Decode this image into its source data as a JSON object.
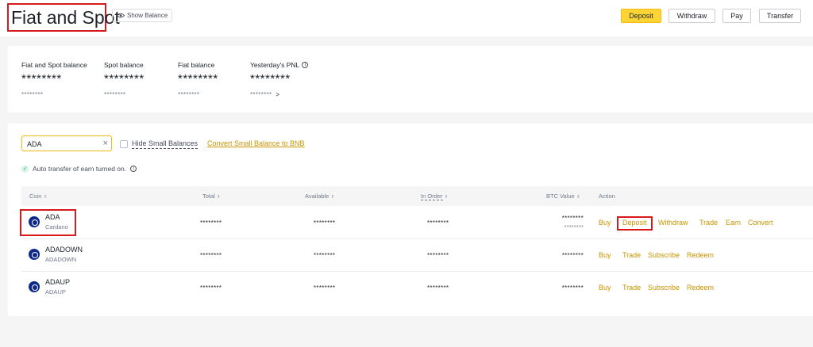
{
  "header": {
    "title": "Fiat and Spot",
    "show_balance": "Show Balance",
    "buttons": {
      "deposit": "Deposit",
      "withdraw": "Withdraw",
      "pay": "Pay",
      "transfer": "Transfer"
    },
    "accent_color": "#fcd535",
    "highlight_color": "#d7191b"
  },
  "balances": [
    {
      "label": "Fiat and Spot balance",
      "value": "********",
      "sub": "********"
    },
    {
      "label": "Spot balance",
      "value": "********",
      "sub": "********"
    },
    {
      "label": "Fiat balance",
      "value": "********",
      "sub": "********"
    },
    {
      "label": "Yesterday's PNL",
      "value": "********",
      "sub": "********",
      "info_icon": "info-icon",
      "arrow": ">"
    }
  ],
  "filters": {
    "search_value": "ADA",
    "hide_small_label": "Hide Small Balances",
    "convert_label": "Convert Small Balance to BNB",
    "auto_transfer": "Auto transfer of earn turned on."
  },
  "table": {
    "headers": {
      "coin": "Coin",
      "total": "Total",
      "available": "Available",
      "in_order": "In Order",
      "btc_value": "BTC Value",
      "action": "Action"
    },
    "rows": [
      {
        "symbol": "ADA",
        "name": "Cardano",
        "total": "********",
        "available": "********",
        "in_order": "********",
        "btc_value": "********",
        "btc_value_sub": "********",
        "actions": {
          "buy": "Buy",
          "deposit": "Deposit",
          "withdraw": "Withdraw",
          "trade": "Trade",
          "earn": "Earn",
          "convert": "Convert"
        }
      },
      {
        "symbol": "ADADOWN",
        "name": "ADADOWN",
        "total": "********",
        "available": "********",
        "in_order": "********",
        "btc_value": "********",
        "actions": {
          "buy": "Buy",
          "trade": "Trade",
          "subscribe": "Subscribe",
          "redeem": "Redeem"
        }
      },
      {
        "symbol": "ADAUP",
        "name": "ADAUP",
        "total": "********",
        "available": "********",
        "in_order": "********",
        "btc_value": "********",
        "actions": {
          "buy": "Buy",
          "trade": "Trade",
          "subscribe": "Subscribe",
          "redeem": "Redeem"
        }
      }
    ],
    "link_color": "#c99400"
  }
}
